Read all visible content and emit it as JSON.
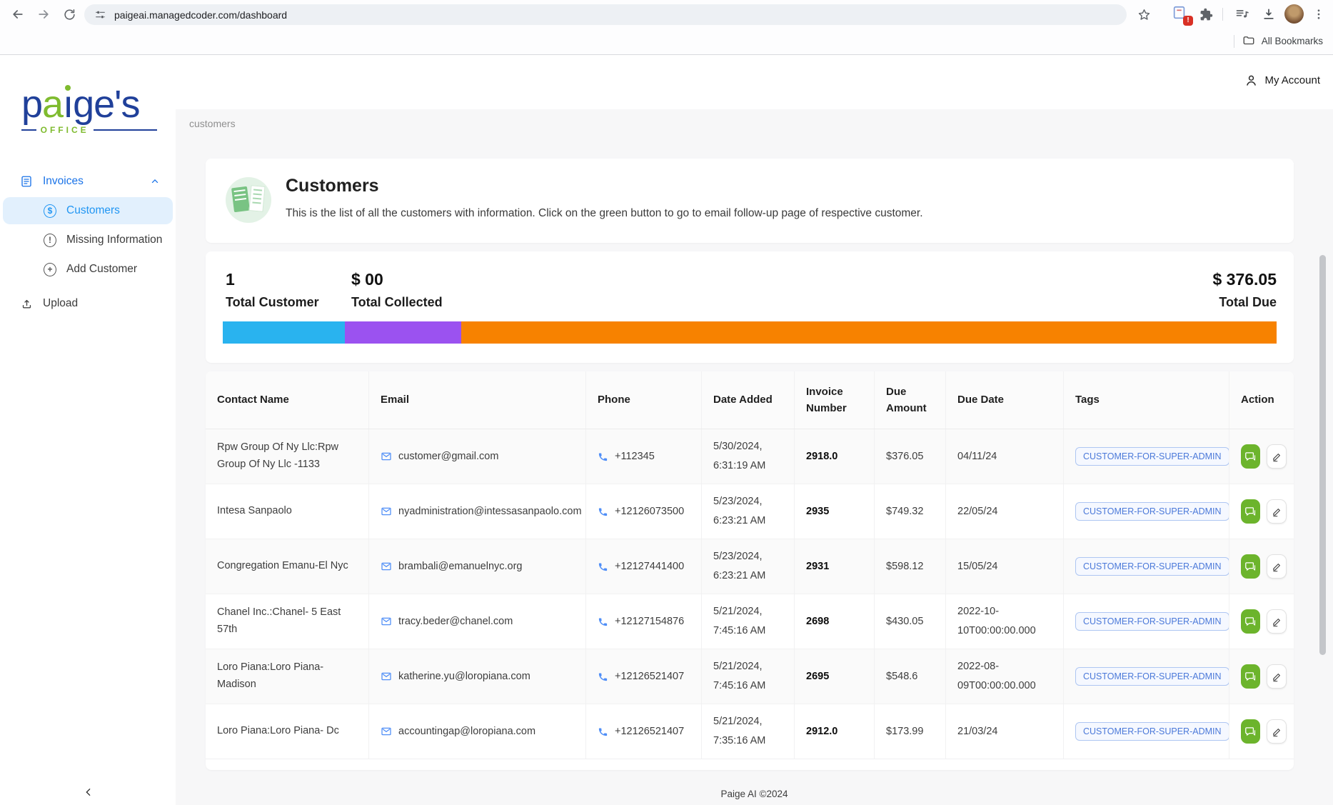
{
  "browser": {
    "url": "paigeai.managedcoder.com/dashboard",
    "extension_badge": "!",
    "all_bookmarks_label": "All Bookmarks"
  },
  "account": {
    "label": "My Account"
  },
  "sidebar": {
    "logo": {
      "p": "p",
      "a": "a",
      "i_dotless": "ı",
      "rest": "ge's",
      "sub": "OFFICE"
    },
    "items": {
      "invoices": "Invoices",
      "customers": "Customers",
      "missing_information": "Missing Information",
      "add_customer": "Add Customer",
      "upload": "Upload"
    }
  },
  "breadcrumb": "customers",
  "page": {
    "title": "Customers",
    "description": "This is the list of all the customers with information. Click on the green button to go to email follow-up page of respective customer."
  },
  "stats": {
    "total_customer_value": "1",
    "total_customer_label": "Total Customer",
    "total_collected_value": "$ 00",
    "total_collected_label": "Total Collected",
    "total_due_value": "$ 376.05",
    "total_due_label": "Total Due",
    "progress": {
      "segments": [
        {
          "name": "segment-1",
          "color": "#29b3ef",
          "percent": 11.6
        },
        {
          "name": "segment-2",
          "color": "#9b52f0",
          "percent": 11.0
        },
        {
          "name": "segment-3",
          "color": "#f78200",
          "percent": 77.4
        }
      ]
    }
  },
  "colors": {
    "accent_green_button": "#6cb42c",
    "tag_blue": "#4b79d9",
    "sidebar_active_blue": "#2196f3",
    "logo_blue": "#20409a",
    "logo_green": "#7fbb2f"
  },
  "table": {
    "columns": [
      "Contact Name",
      "Email",
      "Phone",
      "Date Added",
      "Invoice Number",
      "Due Amount",
      "Due Date",
      "Tags",
      "Action"
    ],
    "rows": [
      {
        "name": "Rpw Group Of Ny Llc:Rpw Group Of Ny Llc -1133",
        "email": "customer@gmail.com",
        "phone": "+112345",
        "date_added": "5/30/2024, 6:31:19 AM",
        "invoice_number": "2918.0",
        "due_amount": "$376.05",
        "due_date": "04/11/24",
        "tag": "CUSTOMER-FOR-SUPER-ADMIN"
      },
      {
        "name": "Intesa Sanpaolo",
        "email": "nyadministration@intessasanpaolo.com",
        "phone": "+12126073500",
        "date_added": "5/23/2024, 6:23:21 AM",
        "invoice_number": "2935",
        "due_amount": "$749.32",
        "due_date": "22/05/24",
        "tag": "CUSTOMER-FOR-SUPER-ADMIN"
      },
      {
        "name": "Congregation Emanu-El Nyc",
        "email": "brambali@emanuelnyc.org",
        "phone": "+12127441400",
        "date_added": "5/23/2024, 6:23:21 AM",
        "invoice_number": "2931",
        "due_amount": "$598.12",
        "due_date": "15/05/24",
        "tag": "CUSTOMER-FOR-SUPER-ADMIN"
      },
      {
        "name": "Chanel Inc.:Chanel- 5 East 57th",
        "email": "tracy.beder@chanel.com",
        "phone": "+12127154876",
        "date_added": "5/21/2024, 7:45:16 AM",
        "invoice_number": "2698",
        "due_amount": "$430.05",
        "due_date": "2022-10-10T00:00:00.000",
        "tag": "CUSTOMER-FOR-SUPER-ADMIN"
      },
      {
        "name": "Loro Piana:Loro Piana- Madison",
        "email": "katherine.yu@loropiana.com",
        "phone": "+12126521407",
        "date_added": "5/21/2024, 7:45:16 AM",
        "invoice_number": "2695",
        "due_amount": "$548.6",
        "due_date": "2022-08-09T00:00:00.000",
        "tag": "CUSTOMER-FOR-SUPER-ADMIN"
      },
      {
        "name": "Loro Piana:Loro Piana- Dc",
        "email": "accountingap@loropiana.com",
        "phone": "+12126521407",
        "date_added": "5/21/2024, 7:35:16 AM",
        "invoice_number": "2912.0",
        "due_amount": "$173.99",
        "due_date": "21/03/24",
        "tag": "CUSTOMER-FOR-SUPER-ADMIN"
      }
    ]
  },
  "footer": "Paige AI ©2024"
}
